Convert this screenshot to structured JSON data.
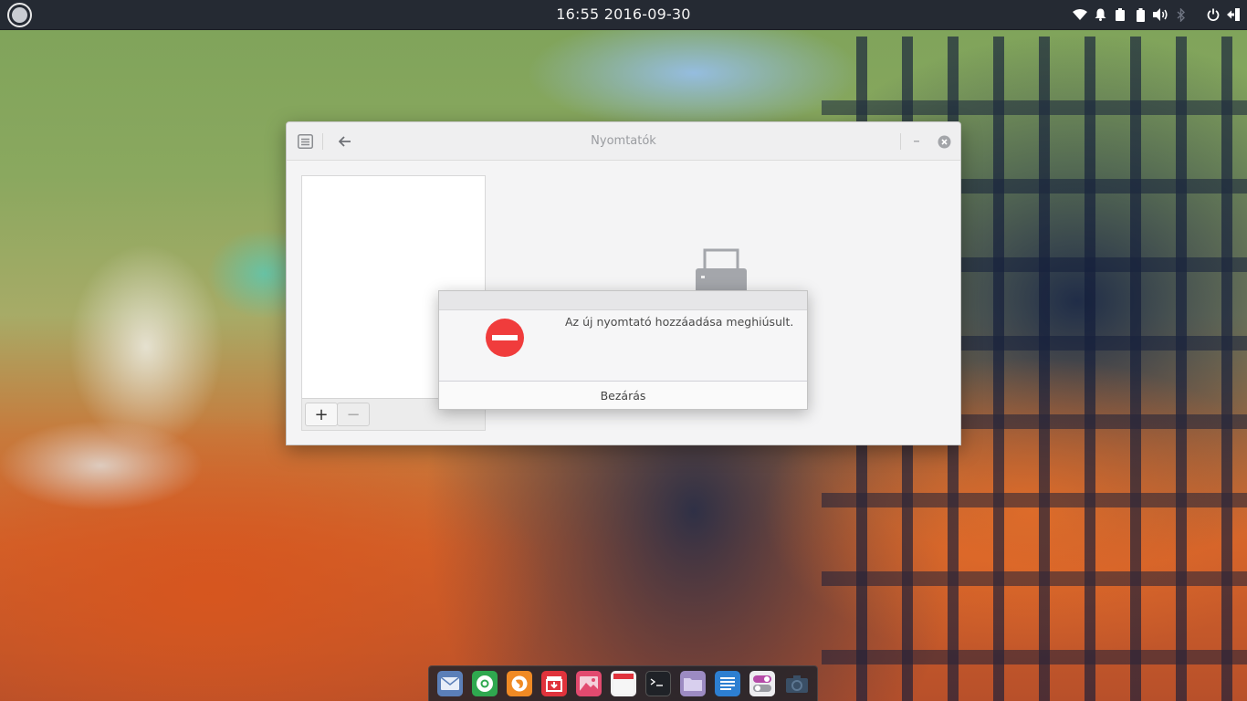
{
  "top_panel": {
    "time": "16:55",
    "date": "2016-09-30",
    "tray_icons": [
      "wifi-icon",
      "notification-bell-icon",
      "clipboard-icon",
      "battery-icon",
      "volume-icon",
      "bluetooth-icon",
      "power-icon",
      "logout-icon"
    ]
  },
  "window": {
    "title": "Nyomtatók",
    "header_icons": [
      "printer-app-icon",
      "back-arrow-icon",
      "minimize-icon",
      "close-icon"
    ],
    "sidebar": {
      "add_label": "+",
      "remove_label": "−"
    }
  },
  "dialog": {
    "message": "Az új nyomtató hozzáadása meghiúsult.",
    "button_label": "Bezárás",
    "icon": "error-stop-icon",
    "icon_color": "#f03c3c"
  },
  "dock": {
    "items": [
      "mail-icon",
      "chrome-icon",
      "firefox-icon",
      "software-store-icon",
      "image-viewer-icon",
      "calendar-icon",
      "terminal-icon",
      "files-icon",
      "text-editor-icon",
      "settings-toggle-icon",
      "screenshot-icon"
    ]
  },
  "colors": {
    "panel_bg": "#252a33",
    "error_red": "#f03c3c"
  }
}
